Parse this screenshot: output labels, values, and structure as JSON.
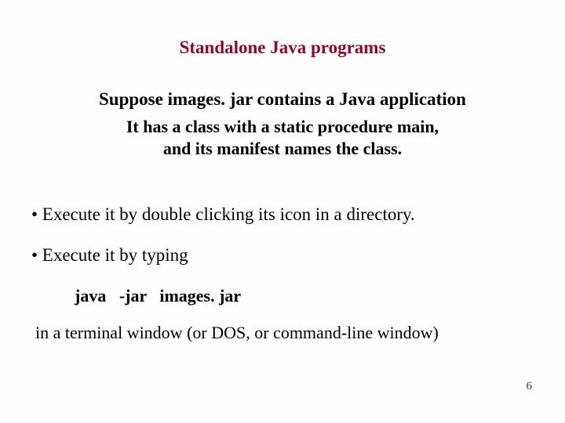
{
  "title": "Standalone Java programs",
  "subtitle1": "Suppose images. jar contains a Java application",
  "subtitle2_line1": "It has a class with a static procedure main,",
  "subtitle2_line2": "and its manifest names the class.",
  "bullet1": "• Execute it by double clicking its icon in a directory.",
  "bullet2": "• Execute it by typing",
  "command": "java   -jar   images. jar",
  "bullet3": "in a terminal window (or DOS, or command-line window)",
  "page_number": "6"
}
